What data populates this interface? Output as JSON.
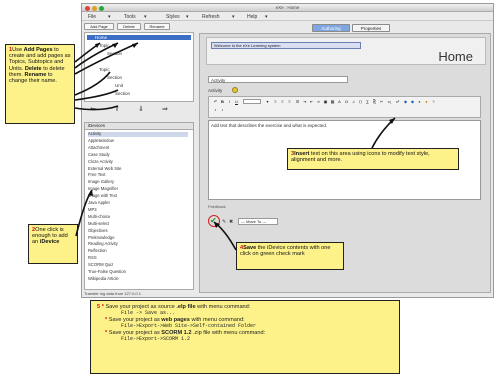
{
  "window": {
    "title": "eXe : Home",
    "menu": [
      "File",
      "Tools",
      "Styles",
      "Refresh",
      "Help"
    ]
  },
  "outline": {
    "toolbar": [
      "Add Page",
      "Delete",
      "Rename"
    ],
    "tree": [
      {
        "label": "Home",
        "selected": true
      },
      {
        "label": "Topic",
        "selected": false
      },
      {
        "label": "Section",
        "selected": false
      },
      {
        "label": "Topic",
        "selected": false
      },
      {
        "label": "Section",
        "selected": false
      },
      {
        "label": "Unit",
        "selected": false
      },
      {
        "label": "Section",
        "selected": false
      }
    ],
    "move_buttons": [
      "⇐",
      "⇑",
      "⇓",
      "⇒"
    ]
  },
  "idevices": {
    "header": "iDevices",
    "items": [
      "Activity",
      "Appletwindow",
      "Attachment",
      "Case Study",
      "Cloze Activity",
      "External Web Site",
      "Free Text",
      "Image Gallery",
      "Image Magnifier",
      "Image with Text",
      "Java Applet",
      "MP3",
      "Multi-choice",
      "Multi-select",
      "Objectives",
      "Preknowledge",
      "Reading Activity",
      "Reflection",
      "RSS",
      "SCORM Quiz",
      "True-False Question",
      "Wikipedia Article"
    ]
  },
  "status_bar": "Transfer log data from 127.0.0.1",
  "tabs": [
    "Authoring",
    "Properties"
  ],
  "editor": {
    "info_field": "Welcome to the eXe Learning system",
    "page_title": "Home",
    "title_label": "Activity",
    "activity_label": "Activity",
    "body_text": "Add text that describes the exercise and what is expected.",
    "bottom_text": "Feedback",
    "move_to_label": "--- Move To ---"
  },
  "callouts": {
    "c1": {
      "num": "1",
      "parts": [
        "Use ",
        "Add Pages",
        " to create and add pages as Topics, Subtopics and Units. ",
        "Delete",
        " to delete them. ",
        "Rename",
        " to change their name."
      ]
    },
    "c2": {
      "num": "2",
      "parts": [
        "One click is enough to add an ",
        "iDevice"
      ]
    },
    "c3": {
      "num": "3",
      "parts": [
        "Insert",
        " text on this area using icons to modify text style, alignment and more."
      ]
    },
    "c4": {
      "num": "4",
      "parts": [
        "Save",
        " the iDevice contents with one click on green check mark"
      ]
    }
  },
  "tips": {
    "num": "5",
    "line1_pre": "Save your project as source ",
    "line1_bold": ".elp file",
    "line1_post": " with menu command:",
    "line1_cmd": "File -> Save as...",
    "line2_pre": "Save your project as ",
    "line2_bold": "web pages",
    "line2_post": " with menu command:",
    "line2_cmd": "File->Export->Web Site->Self-contained Folder",
    "line3_pre": "Save your project as ",
    "line3_bold": "SCORM 1.2",
    "line3_post": " .zip file with menu command:",
    "line3_cmd": "File->Export->SCORM 1.2"
  },
  "colors": {
    "callout_bg": "#fdf28a",
    "number": "#cc1111",
    "selection": "#3b6ec4",
    "info_field": "#d9dff0"
  }
}
